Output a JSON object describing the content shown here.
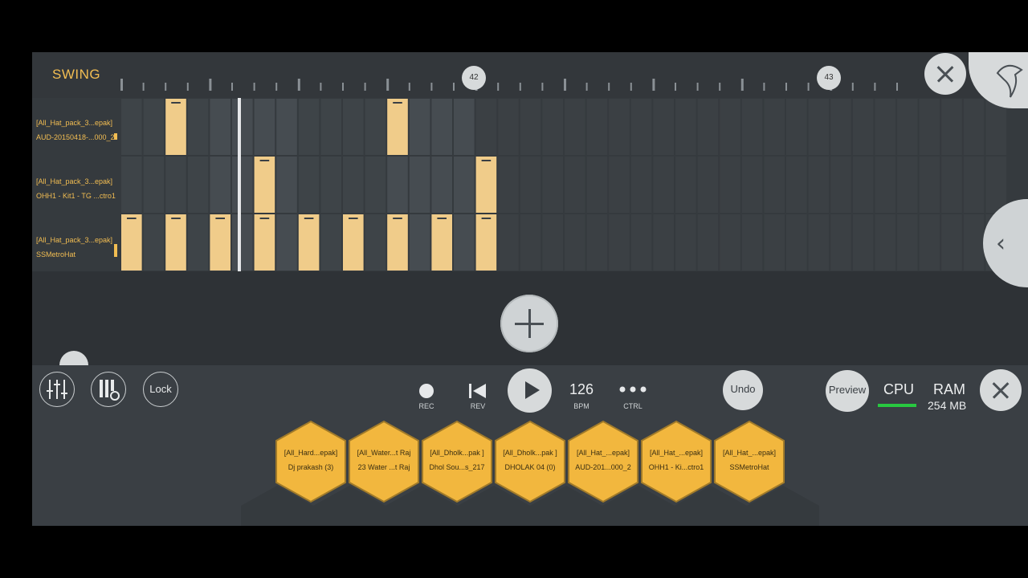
{
  "header": {
    "swing_label": "SWING",
    "bar_markers": [
      "42",
      "43"
    ]
  },
  "channels": [
    {
      "line1": "[All_Hat_pack_3...epak]",
      "line2": "AUD-20150418-...000_2",
      "steps": [
        3,
        13
      ],
      "volume": 0.15
    },
    {
      "line1": "[All_Hat_pack_3...epak]",
      "line2": "OHH1 - Kit1 - TG ...ctro1",
      "steps": [
        7,
        17
      ],
      "volume": 0
    },
    {
      "line1": "[All_Hat_pack_3...epak]",
      "line2": "SSMetroHat",
      "steps": [
        1,
        3,
        5,
        7,
        9,
        11,
        13,
        15,
        17
      ],
      "volume": 0.3
    }
  ],
  "toolbar": {
    "lock_label": "Lock",
    "rec_label": "REC",
    "rev_label": "REV",
    "bpm_value": "126",
    "bpm_label": "BPM",
    "ctrl_label": "CTRL",
    "undo_label": "Undo",
    "preview_label": "Preview",
    "cpu_label": "CPU",
    "ram_label": "RAM",
    "ram_value": "254 MB"
  },
  "pads": [
    {
      "line1": "[All_Hard...epak]",
      "line2": "Dj prakash (3)"
    },
    {
      "line1": "[All_Water...t Raj",
      "line2": "23 Water ...t Raj"
    },
    {
      "line1": "[All_Dholk...pak ]",
      "line2": "Dhol Sou...s_217"
    },
    {
      "line1": "[All_Dholk...pak ]",
      "line2": "DHOLAK  04 (0)"
    },
    {
      "line1": "[All_Hat_...epak]",
      "line2": "AUD-201...000_2"
    },
    {
      "line1": "[All_Hat_...epak]",
      "line2": "OHH1 - Ki...ctro1"
    },
    {
      "line1": "[All_Hat_...epak]",
      "line2": "SSMetroHat"
    }
  ],
  "colors": {
    "accent": "#f2bd52",
    "step_fill": "#f0cc8a",
    "pad_fill": "#f2b73e",
    "cpu_meter": "#28c840"
  },
  "icons": [
    "mixer-icon",
    "piano-settings-icon",
    "record-icon",
    "rewind-icon",
    "play-icon",
    "ctrl-dots-icon",
    "close-icon",
    "collapse-chevron-icon",
    "fl-logo-icon",
    "add-icon"
  ]
}
